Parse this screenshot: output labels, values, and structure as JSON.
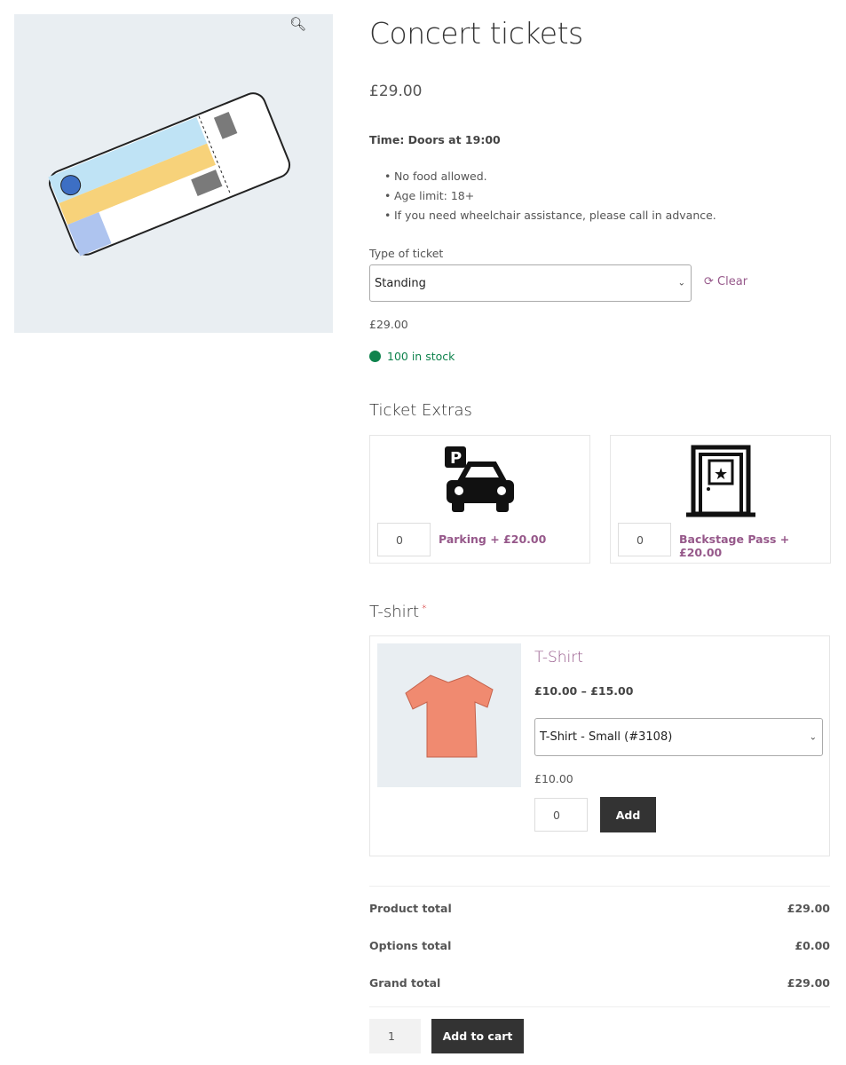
{
  "product": {
    "title": "Concert tickets",
    "price": "£29.00",
    "time": "Time: Doors at 19:00",
    "notes": [
      "No food allowed.",
      "Age limit: 18+",
      "If you need wheelchair assistance, please call in advance."
    ]
  },
  "variation": {
    "label": "Type of ticket",
    "selected": "Standing",
    "clear": "Clear",
    "price": "£29.00",
    "stock": "100 in stock"
  },
  "extras": {
    "heading": "Ticket Extras",
    "items": [
      {
        "qty": "0",
        "label": "Parking + £20.00",
        "icon": "car-parking-icon"
      },
      {
        "qty": "0",
        "label": "Backstage Pass + £20.00",
        "icon": "backstage-door-icon"
      }
    ]
  },
  "tshirt": {
    "heading": "T-shirt",
    "required": "*",
    "name": "T-Shirt",
    "price_range": "£10.00 – £15.00",
    "selected": "T-Shirt - Small (#3108)",
    "price": "£10.00",
    "qty": "0",
    "add": "Add"
  },
  "totals": [
    {
      "label": "Product total",
      "value": "£29.00"
    },
    {
      "label": "Options total",
      "value": "£0.00"
    },
    {
      "label": "Grand total",
      "value": "£29.00"
    }
  ],
  "cart": {
    "qty": "1",
    "button": "Add to cart"
  },
  "colors": {
    "accent": "#96588a",
    "stock": "#0f834d",
    "button": "#333333"
  }
}
